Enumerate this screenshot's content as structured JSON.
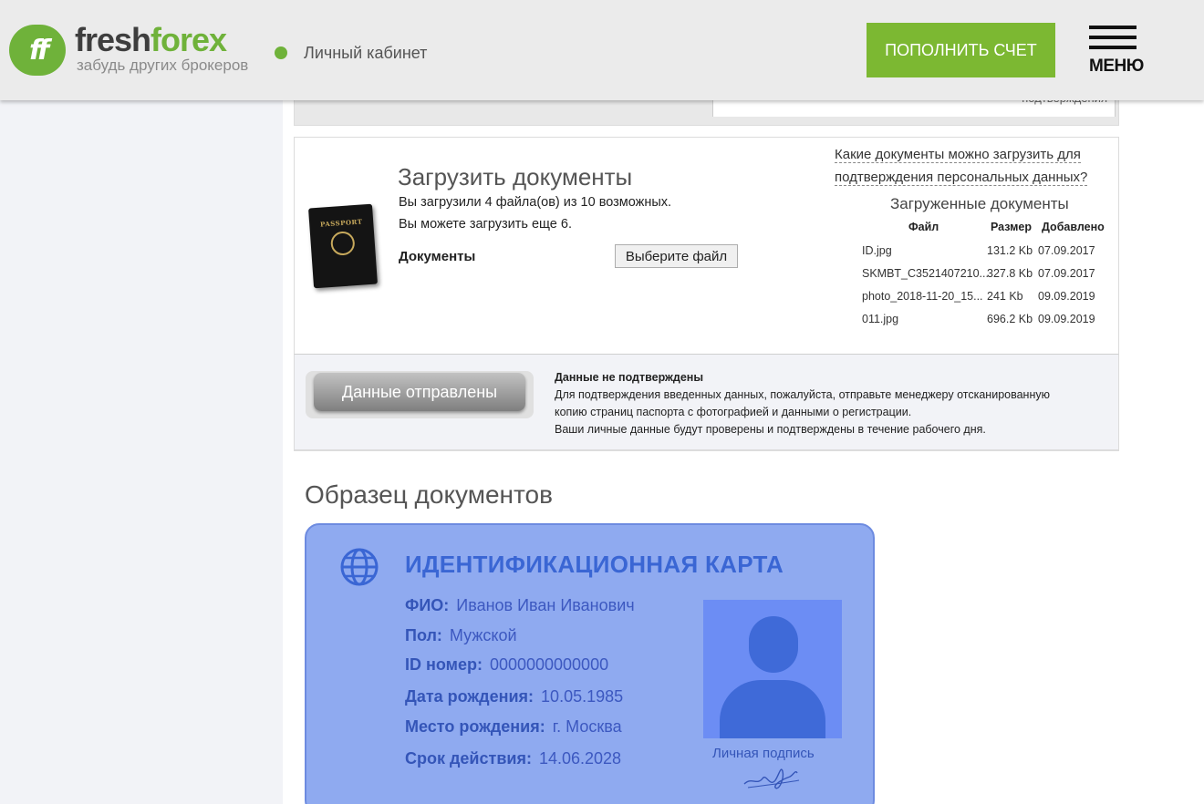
{
  "header": {
    "logo_mark": "ff",
    "logo_fresh": "fresh",
    "logo_forex": "forex",
    "logo_tagline": "забудь других брокеров",
    "cabinet_label": "Личный кабинет",
    "topup_label": "ПОПОЛНИТЬ СЧЕТ",
    "menu_label": "МЕНЮ",
    "accent_color": "#6fb23a"
  },
  "prev_section": {
    "cut_text": "подтверждения"
  },
  "upload": {
    "title": "Загрузить документы",
    "uploaded_line": "Вы загрузили 4 файла(ов) из 10 возможных.",
    "remaining_line": "Вы можете загрузить еще 6.",
    "documents_label": "Документы",
    "choose_file_label": "Выберите файл",
    "which_docs_link": "Какие документы можно загрузить для подтверждения персональных данных?",
    "passport_text": "PASSPORT",
    "uploaded_docs": {
      "title": "Загруженные документы",
      "columns": [
        "Файл",
        "Размер",
        "Добавлено"
      ],
      "rows": [
        {
          "file": "ID.jpg",
          "size": "131.2 Kb",
          "date": "07.09.2017"
        },
        {
          "file": "SKMBT_C3521407210...",
          "size": "327.8 Kb",
          "date": "07.09.2017"
        },
        {
          "file": "photo_2018-11-20_15...",
          "size": "241 Kb",
          "date": "09.09.2019"
        },
        {
          "file": "011.jpg",
          "size": "696.2 Kb",
          "date": "09.09.2019"
        }
      ]
    }
  },
  "status": {
    "button_label": "Данные отправлены",
    "title": "Данные не подтверждены",
    "lines": [
      "Для подтверждения введенных данных, пожалуйста, отправьте менеджеру отсканированную",
      "копию страниц паспорта с фотографией и данными о регистрации.",
      "Ваши личные данные будут проверены и подтверждены в течение рабочего дня."
    ]
  },
  "sample": {
    "title": "Образец документов",
    "card": {
      "title": "ИДЕНТИФИКАЦИОННАЯ КАРТА",
      "fields": [
        {
          "label": "ФИО:",
          "value": "Иванов Иван Иванович"
        },
        {
          "label": "Пол:",
          "value": "Мужской"
        },
        {
          "label": "ID номер:",
          "value": "0000000000000"
        },
        {
          "label": "Дата рождения:",
          "value": "10.05.1985"
        },
        {
          "label": "Место рождения:",
          "value": "г. Москва"
        },
        {
          "label": "Срок действия:",
          "value": "14.06.2028"
        }
      ],
      "signature_label": "Личная подпись",
      "card_color": "#8faaf0"
    }
  }
}
